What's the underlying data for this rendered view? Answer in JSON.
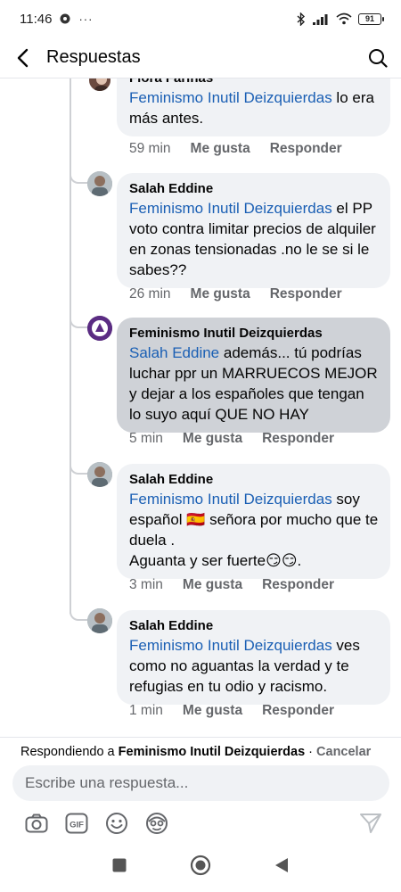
{
  "status": {
    "time": "11:46",
    "extra": "···",
    "battery": "91"
  },
  "header": {
    "title": "Respuestas"
  },
  "comments": [
    {
      "author": "Flora Fariñas",
      "mention": "Feminismo Inutil Deizquierdas",
      "text": " lo era más antes.",
      "time": "59 min"
    },
    {
      "author": "Salah Eddine",
      "mention": "Feminismo Inutil Deizquierdas",
      "text": " el PP voto contra limitar precios de alquiler en zonas tensionadas .no le se si le sabes??",
      "time": "26 min"
    },
    {
      "author": "Feminismo Inutil Deizquierdas",
      "mention": "Salah Eddine",
      "text": " además...  tú podrías luchar ppr un MARRUECOS MEJOR y dejar a los españoles que tengan lo suyo aquí QUE NO HAY",
      "time": "5 min"
    },
    {
      "author": "Salah Eddine",
      "mention": "Feminismo Inutil Deizquierdas",
      "text": " soy español 🇪🇸 señora por mucho que te duela .",
      "text2": "Aguanta y ser fuerte😏😏.",
      "time": "3 min"
    },
    {
      "author": "Salah Eddine",
      "mention": "Feminismo Inutil Deizquierdas",
      "text": " ves como no aguantas la verdad y te refugias en tu odio y racismo.",
      "time": "1 min"
    }
  ],
  "actions": {
    "like": "Me gusta",
    "reply": "Responder"
  },
  "reply": {
    "prefix": "Respondiendo a ",
    "target": "Feminismo Inutil Deizquierdas",
    "separator": " · ",
    "cancel": "Cancelar",
    "placeholder": "Escribe una respuesta..."
  },
  "toolbar": {
    "gif_label": "GIF"
  },
  "colors": {
    "mention": "#1a5fb4",
    "meta": "#65676b",
    "bubble": "#f0f2f5",
    "bubble_highlight": "#cfd2d7"
  }
}
